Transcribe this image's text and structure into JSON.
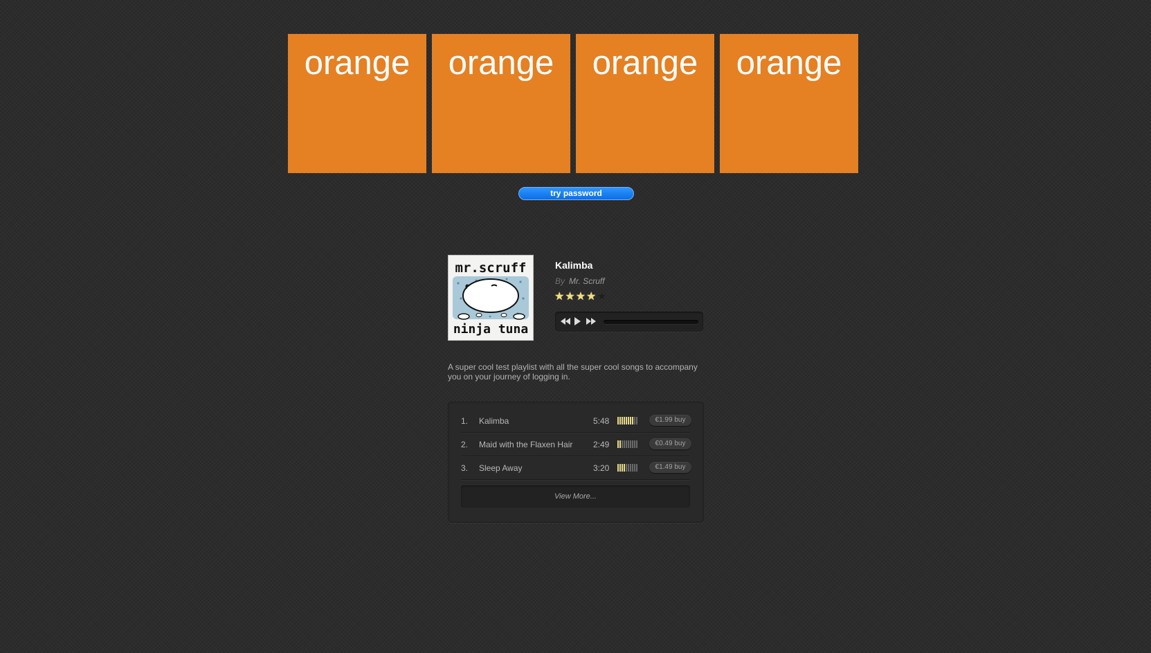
{
  "tiles": [
    {
      "label": "orange"
    },
    {
      "label": "orange"
    },
    {
      "label": "orange"
    },
    {
      "label": "orange"
    }
  ],
  "try_button": {
    "label": "try password"
  },
  "album": {
    "art_top_text": "mr.scruff",
    "art_bottom_text": "ninja tuna"
  },
  "now_playing": {
    "title": "Kalimba",
    "by_label": "By",
    "artist": "Mr. Scruff",
    "rating": 4,
    "rating_max": 5
  },
  "player": {
    "rewind_icon": "rewind-icon",
    "play_icon": "play-icon",
    "fast_forward_icon": "fast-forward-icon",
    "progress": 0
  },
  "description": "A super cool test playlist with all the super cool songs to accompany you on your journey of logging in.",
  "tracks": [
    {
      "num": "1.",
      "title": "Kalimba",
      "duration": "5:48",
      "popularity": 0.8,
      "price": "€1.99 buy"
    },
    {
      "num": "2.",
      "title": "Maid with the Flaxen Hair",
      "duration": "2:49",
      "popularity": 0.2,
      "price": "€0.49 buy"
    },
    {
      "num": "3.",
      "title": "Sleep Away",
      "duration": "3:20",
      "popularity": 0.4,
      "price": "€1.49 buy"
    }
  ],
  "view_more": "View More...",
  "colors": {
    "tile": "#e58023",
    "button": "#1a82f7",
    "star_on": "#f2e07a",
    "popularity_on": "#e8dc8a",
    "popularity_off": "#6a6a6a"
  }
}
